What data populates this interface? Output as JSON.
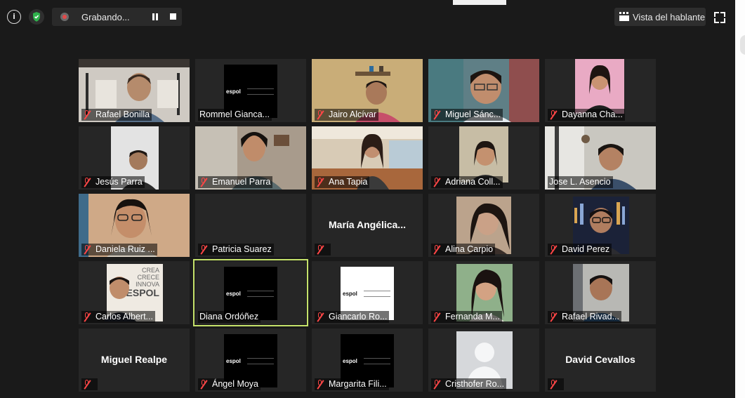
{
  "toolbar": {
    "recording_label": "Grabando...",
    "speaker_view_label": "Vista del hablante"
  },
  "participants": [
    {
      "name": "Rafael Bonilla"
    },
    {
      "name": "Rommel Gianca..."
    },
    {
      "name": "Jairo Alcívar"
    },
    {
      "name": "Miguel Sánc..."
    },
    {
      "name": "Dayanna Cha..."
    },
    {
      "name": "Jesús Parra"
    },
    {
      "name": "Emanuel Parra"
    },
    {
      "name": "Ana Tapia"
    },
    {
      "name": "Adriana Coll..."
    },
    {
      "name": "Jose L. Asencio"
    },
    {
      "name": "Daniela Ruiz ..."
    },
    {
      "name": "Patricia Suarez"
    },
    {
      "name": "María  Angélica..."
    },
    {
      "name": "Alina Carpio"
    },
    {
      "name": "David Perez"
    },
    {
      "name": "Carlos Albert..."
    },
    {
      "name": "Diana Ordóñez"
    },
    {
      "name": "Giancarlo Ro..."
    },
    {
      "name": "Fernanda M..."
    },
    {
      "name": "Rafael Rivad..."
    },
    {
      "name": "Miguel Realpe"
    },
    {
      "name": "Ángel Moya"
    },
    {
      "name": "Margarita Fili..."
    },
    {
      "name": "Cristhofer Ro..."
    },
    {
      "name": "David Cevallos"
    }
  ],
  "logo_text": "espol",
  "poster_text": [
    "CREA",
    "CRECE",
    "INNOVA",
    "ESPOL"
  ]
}
